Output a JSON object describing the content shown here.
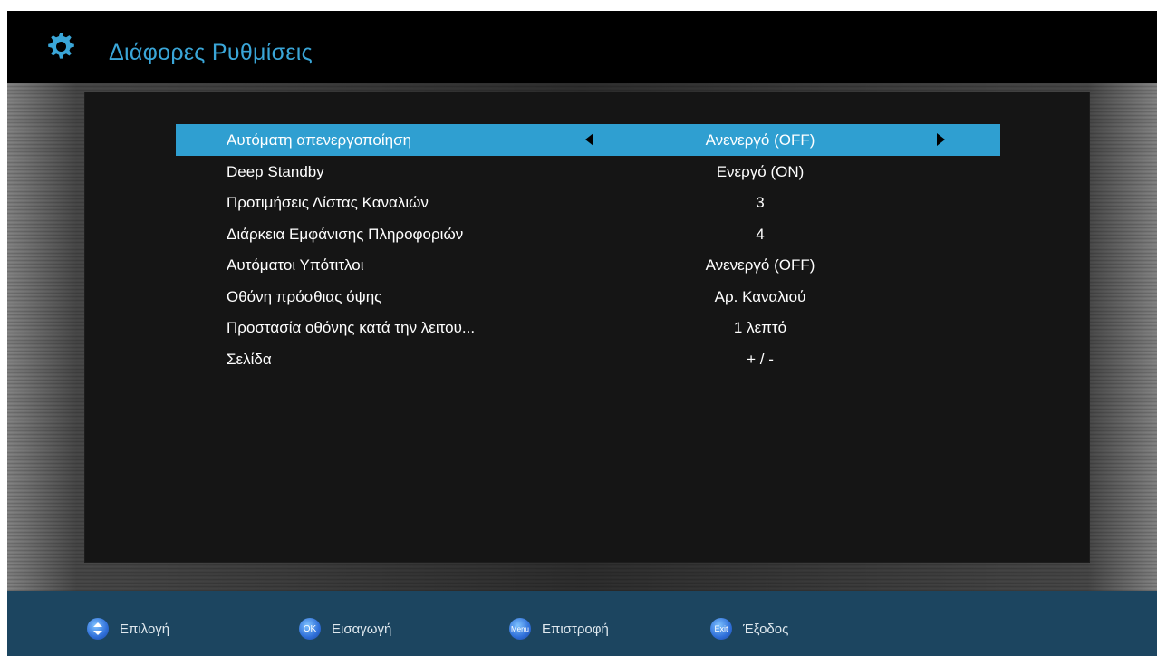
{
  "header": {
    "title": "Διάφορες Ρυθμίσεις",
    "icon": "gear-icon",
    "accent_color": "#3aa6d8"
  },
  "menu": {
    "selected_index": 0,
    "highlight_color": "#2f9fd1",
    "items": [
      {
        "label": "Αυτόματη απενεργοποίηση",
        "value": "Ανενεργό (OFF)"
      },
      {
        "label": "Deep Standby",
        "value": "Ενεργό (ON)"
      },
      {
        "label": "Προτιμήσεις Λίστας Καναλιών",
        "value": "3"
      },
      {
        "label": "Διάρκεια Εμφάνισης Πληροφοριών",
        "value": "4"
      },
      {
        "label": "Αυτόματοι Υπότιτλοι",
        "value": "Ανενεργό (OFF)"
      },
      {
        "label": "Οθόνη πρόσθιας όψης",
        "value": "Αρ. Καναλιού"
      },
      {
        "label": "Προστασία οθόνης κατά την λειτου...",
        "value": "1 λεπτό"
      },
      {
        "label": "Σελίδα",
        "value": "+ / -"
      }
    ]
  },
  "footer": {
    "background": "#1c4560",
    "hints": [
      {
        "key": "",
        "icon": "updown-arrows-icon",
        "label": "Επιλογή"
      },
      {
        "key": "OK",
        "icon": "ok-button-icon",
        "label": "Εισαγωγή"
      },
      {
        "key": "Menu",
        "icon": "menu-button-icon",
        "label": "Επιστροφή"
      },
      {
        "key": "Exit",
        "icon": "exit-button-icon",
        "label": "Έξοδος"
      }
    ]
  }
}
